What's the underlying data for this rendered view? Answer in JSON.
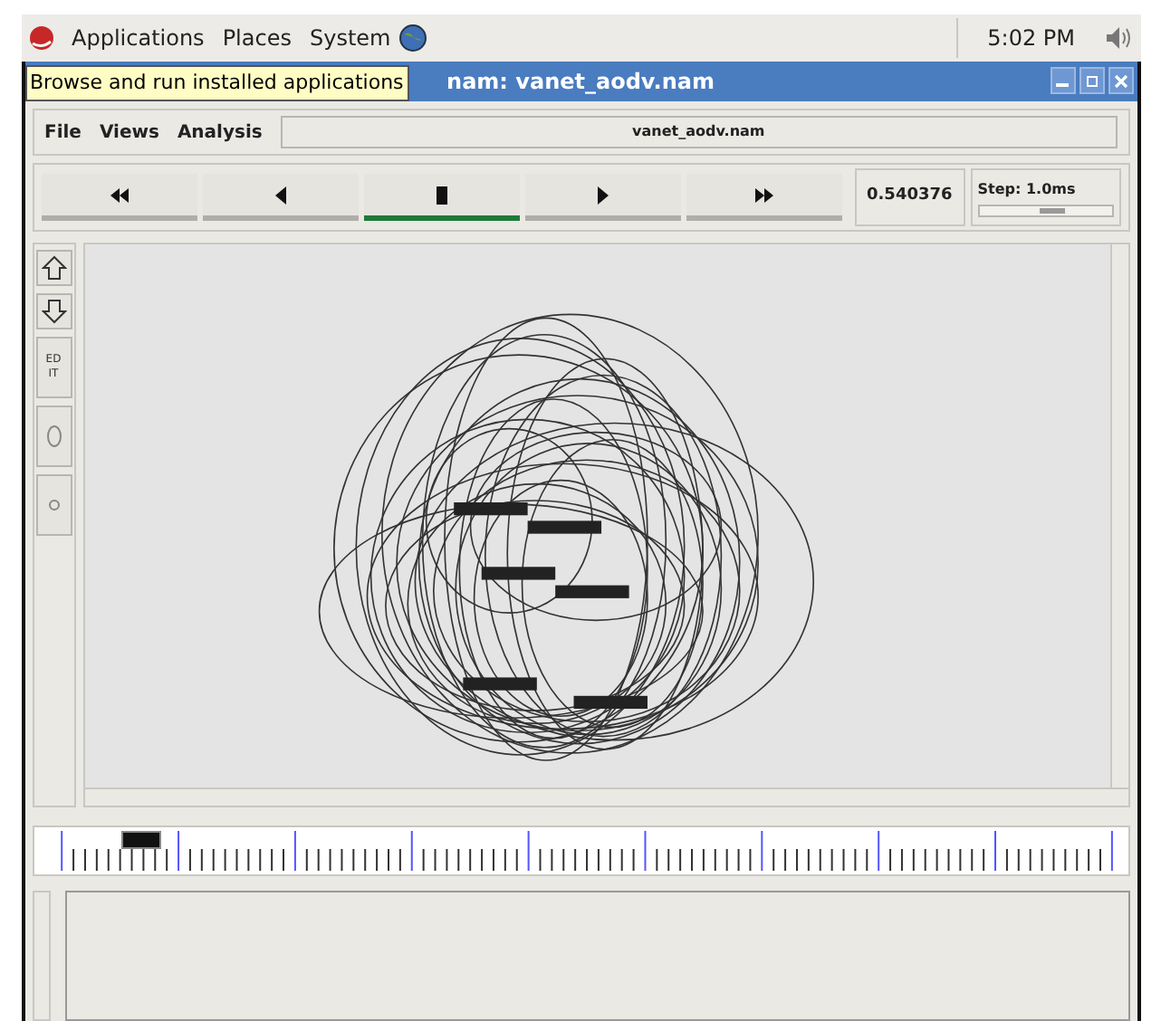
{
  "panel": {
    "menus": [
      "Applications",
      "Places",
      "System"
    ],
    "clock": "5:02 PM"
  },
  "tooltip": "Browse and run installed applications",
  "window": {
    "title": "nam: vanet_aodv.nam"
  },
  "menu": [
    "File",
    "Views",
    "Analysis"
  ],
  "file_name": "vanet_aodv.nam",
  "controls": [
    {
      "kind": "rewind",
      "selected": false
    },
    {
      "kind": "back",
      "selected": false
    },
    {
      "kind": "stop",
      "selected": true
    },
    {
      "kind": "play",
      "selected": false
    },
    {
      "kind": "forward",
      "selected": false
    }
  ],
  "time": "0.540376",
  "step": {
    "label": "Step: 1.0ms",
    "level": 0.55
  },
  "tools": [
    {
      "kind": "zoom-in"
    },
    {
      "kind": "zoom-out"
    },
    {
      "kind": "edit",
      "label": "ED IT"
    },
    {
      "kind": "large-node"
    },
    {
      "kind": "small-node"
    }
  ],
  "timeline": {
    "level": 0.08
  }
}
